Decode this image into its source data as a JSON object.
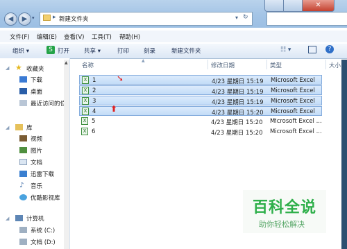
{
  "address": {
    "path": "新建文件夹"
  },
  "menu": [
    "文件(F)",
    "编辑(E)",
    "查看(V)",
    "工具(T)",
    "帮助(H)"
  ],
  "toolbar": {
    "organize": "组织",
    "open": "打开",
    "share": "共享",
    "print": "打印",
    "burn": "刻录",
    "new_folder": "新建文件夹"
  },
  "sidebar": {
    "favorites": "收藏夹",
    "downloads": "下载",
    "desktop": "桌面",
    "recent": "最近访问的位",
    "libraries": "库",
    "videos": "视频",
    "pictures": "图片",
    "documents": "文档",
    "xunlei": "迅雷下载",
    "music": "音乐",
    "youku": "优酷影视库",
    "computer": "计算机",
    "drive_c": "系统 (C:)",
    "drive_d": "文档 (D:)"
  },
  "columns": {
    "name": "名称",
    "modified": "修改日期",
    "type": "类型",
    "size": "大小"
  },
  "files": [
    {
      "name": "1",
      "modified": "4/23 星期日 15:19",
      "type": "Microsoft Excel ...",
      "selected": true
    },
    {
      "name": "2",
      "modified": "4/23 星期日 15:19",
      "type": "Microsoft Excel ...",
      "selected": true
    },
    {
      "name": "3",
      "modified": "4/23 星期日 15:19",
      "type": "Microsoft Excel ...",
      "selected": true
    },
    {
      "name": "4",
      "modified": "4/23 星期日 15:20",
      "type": "Microsoft Excel ...",
      "selected": true
    },
    {
      "name": "5",
      "modified": "4/23 星期日 15:20",
      "type": "Microsoft Excel ...",
      "selected": false
    },
    {
      "name": "6",
      "modified": "4/23 星期日 15:20",
      "type": "Microsoft Excel ...",
      "selected": false
    }
  ],
  "watermark": {
    "title": "百科全说",
    "subtitle": "助你轻松解决"
  },
  "colors": {
    "selection": "#cde3fa",
    "selection_border": "#84acdd",
    "watermark": "#2eaf4a",
    "arrow": "#e02424"
  }
}
